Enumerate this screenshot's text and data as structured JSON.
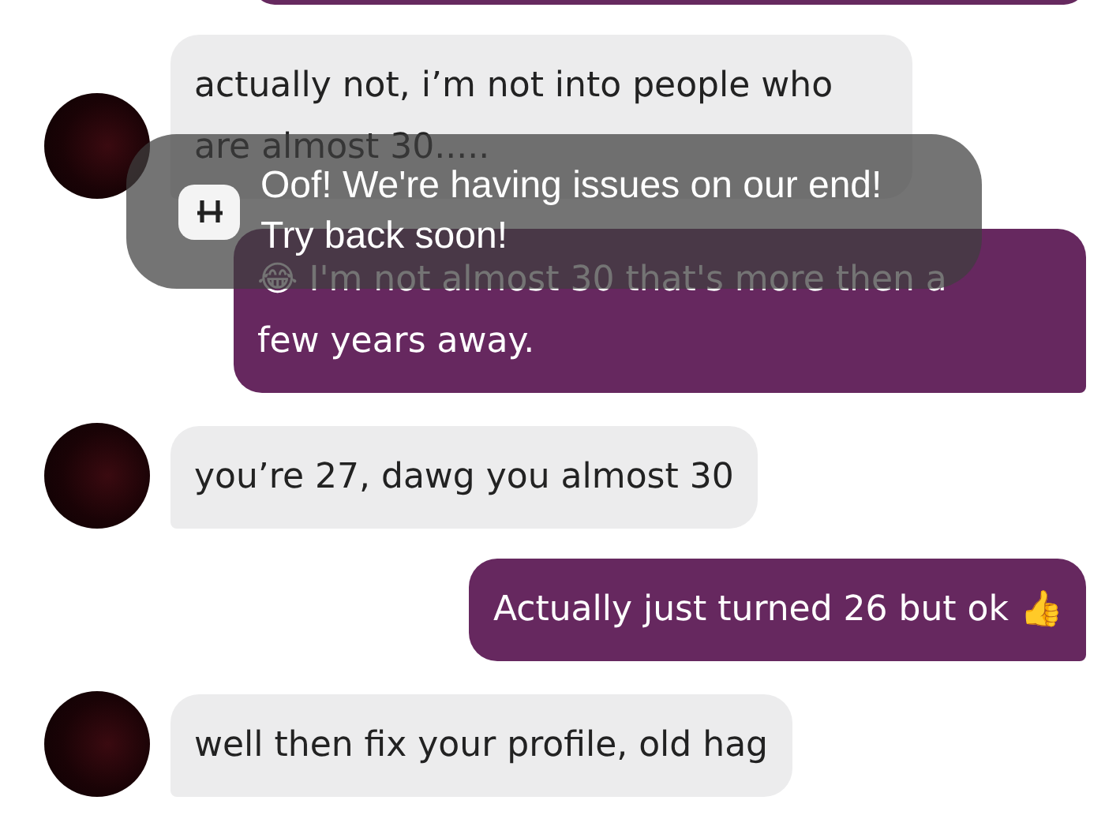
{
  "messages": [
    {
      "kind": "incoming",
      "text": "actually not, i’m not into people who are almost 30....."
    },
    {
      "kind": "outgoing",
      "text": "😂 I'm not almost 30 that's more then a few years away."
    },
    {
      "kind": "incoming",
      "text": "you’re 27, dawg you almost 30"
    },
    {
      "kind": "outgoing",
      "text": "Actually just turned 26 but ok 👍"
    },
    {
      "kind": "incoming",
      "text": "well then fix your profile, old hag"
    }
  ],
  "toast": {
    "text": "Oof! We're having issues on our end! Try back soon!"
  }
}
